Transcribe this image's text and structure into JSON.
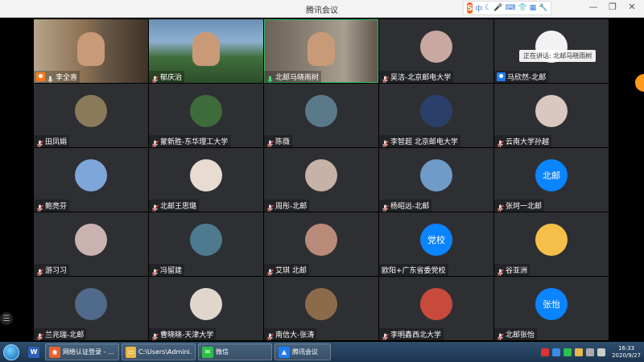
{
  "window": {
    "title": "腾讯会议"
  },
  "ime": {
    "mode": "中"
  },
  "window_controls": {
    "minimize": "—",
    "restore": "❐",
    "close": "✕"
  },
  "speaking": {
    "text": "正在讲话: 北邮马晓雨树"
  },
  "float_button": {
    "label": ""
  },
  "participants": [
    {
      "name": "李全喜",
      "kind": "video",
      "scene": "office",
      "host": "orange",
      "mic": "on"
    },
    {
      "name": "郁庆治",
      "kind": "video",
      "scene": "park",
      "mic": "muted"
    },
    {
      "name": "北邮马晓雨树",
      "kind": "video",
      "scene": "room",
      "mic": "active",
      "active": true
    },
    {
      "name": "吴洁-北京邮电大学",
      "kind": "avatar",
      "avatar": "#c8a8a0",
      "mic": "muted"
    },
    {
      "name": "马欣然-北邮",
      "kind": "avatar",
      "avatar": "#f2f2f2",
      "host": "blue",
      "mic": "none"
    },
    {
      "name": "田凤娟",
      "kind": "avatar",
      "avatar": "#8a7a5a",
      "mic": "muted"
    },
    {
      "name": "蒙新胜-东华理工大学",
      "kind": "avatar",
      "avatar": "#3e6b3a",
      "mic": "muted"
    },
    {
      "name": "陈薇",
      "kind": "avatar",
      "avatar": "#5a7a8a",
      "mic": "muted"
    },
    {
      "name": "李智超 北京邮电大学",
      "kind": "avatar",
      "avatar": "#2b3f6b",
      "mic": "muted"
    },
    {
      "name": "云南大学孙越",
      "kind": "avatar",
      "avatar": "#d9c7c0",
      "mic": "muted"
    },
    {
      "name": "鲍亮芬",
      "kind": "avatar",
      "avatar": "#7fa6d8",
      "mic": "muted"
    },
    {
      "name": "北邮王思璐",
      "kind": "avatar",
      "avatar": "#e8dcd2",
      "mic": "muted"
    },
    {
      "name": "周彤-北邮",
      "kind": "avatar",
      "avatar": "#c6b2a6",
      "mic": "muted"
    },
    {
      "name": "杨昭远-北邮",
      "kind": "avatar",
      "avatar": "#6f9bc8",
      "mic": "muted"
    },
    {
      "name": "张珂一北邮",
      "kind": "avatar-text",
      "avatar_text": "北邮",
      "avatar": "#0a84ff",
      "mic": "muted"
    },
    {
      "name": "游习习",
      "kind": "avatar",
      "avatar": "#c9b2b0",
      "mic": "muted"
    },
    {
      "name": "冯留建",
      "kind": "avatar",
      "avatar": "#4d7a8f",
      "mic": "muted"
    },
    {
      "name": "艾琪 北邮",
      "kind": "avatar",
      "avatar": "#b98a7a",
      "mic": "muted"
    },
    {
      "name": "欧阳+广东省委党校",
      "kind": "avatar-text",
      "avatar_text": "党校",
      "avatar": "#0a84ff",
      "mic": "none"
    },
    {
      "name": "谷亚洲",
      "kind": "avatar",
      "avatar": "#f5c04a",
      "mic": "muted"
    },
    {
      "name": "兰兆瑞-北邮",
      "kind": "avatar",
      "avatar": "#4f6a8a",
      "mic": "muted"
    },
    {
      "name": "曹晓晓-天津大学",
      "kind": "avatar",
      "avatar": "#e0d6cc",
      "mic": "muted"
    },
    {
      "name": "南信大-张涛",
      "kind": "avatar",
      "avatar": "#8c6b4a",
      "mic": "muted"
    },
    {
      "name": "李明鑫西北大学",
      "kind": "avatar",
      "avatar": "#c84a3a",
      "mic": "muted"
    },
    {
      "name": "北邮张怡",
      "kind": "avatar-text",
      "avatar_text": "张怡",
      "avatar": "#0a84ff",
      "mic": "muted"
    }
  ],
  "taskbar": {
    "apps": [
      {
        "label": "",
        "icon": "W",
        "color": "#2b5fb8"
      },
      {
        "label": "网络认证登录 - ...",
        "icon": "◉",
        "color": "#e8622a"
      },
      {
        "label": "C:\\Users\\Admini...",
        "icon": "▭",
        "color": "#e8b84a"
      },
      {
        "label": "微信",
        "icon": "✉",
        "color": "#2fbf4b"
      },
      {
        "label": "腾讯会议",
        "icon": "▲",
        "color": "#1e7cf0"
      }
    ],
    "time": "16:33",
    "date": "2020/9/27"
  },
  "colors": {
    "accent": "#1e7cf0",
    "host": "#ff7a1a",
    "active_border": "#2fbf6b"
  }
}
